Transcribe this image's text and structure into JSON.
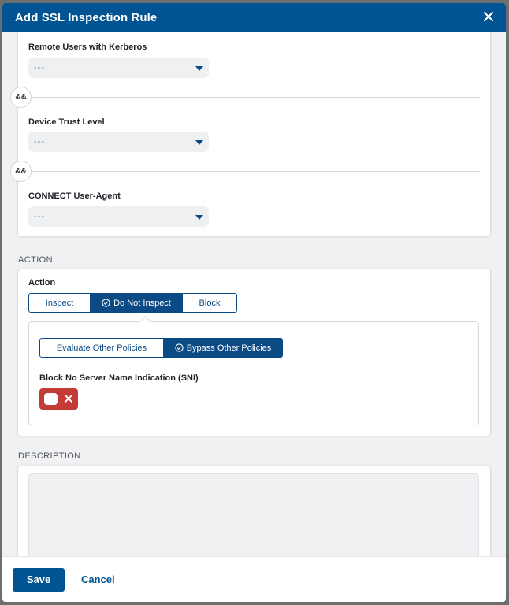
{
  "modal": {
    "title": "Add SSL Inspection Rule"
  },
  "criteria": {
    "remote_users": {
      "label": "Remote Users with Kerberos",
      "value": "---"
    },
    "device_trust": {
      "label": "Device Trust Level",
      "value": "---"
    },
    "user_agent": {
      "label": "CONNECT User-Agent",
      "value": "---"
    },
    "operator": "&&"
  },
  "action": {
    "section_title": "ACTION",
    "label": "Action",
    "options": [
      "Inspect",
      "Do Not Inspect",
      "Block"
    ],
    "selected": "Do Not Inspect",
    "policy_options": [
      "Evaluate Other Policies",
      "Bypass Other Policies"
    ],
    "policy_selected": "Bypass Other Policies",
    "sni_label": "Block No Server Name Indication (SNI)",
    "sni_enabled": false
  },
  "description": {
    "section_title": "DESCRIPTION",
    "value": ""
  },
  "footer": {
    "save_label": "Save",
    "cancel_label": "Cancel"
  },
  "colors": {
    "header": "#015493",
    "accent": "#0c4a85",
    "toggle_off": "#c23b34"
  },
  "icons": {
    "close": "close-icon",
    "check": "check-circle-icon",
    "caret": "caret-down-icon",
    "toggle_x": "x-icon"
  }
}
